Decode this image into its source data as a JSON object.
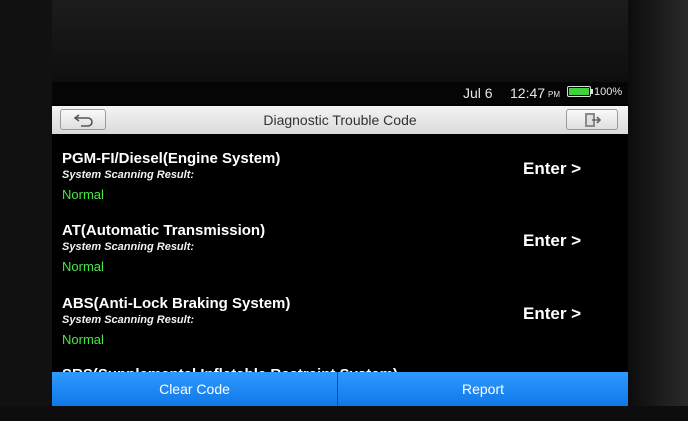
{
  "status_bar": {
    "date": "Jul 6",
    "time": "12:47",
    "ampm": "PM",
    "battery_percent": "100%",
    "battery_level": 1.0,
    "battery_color": "#3fd23a"
  },
  "header": {
    "title": "Diagnostic Trouble Code",
    "back_icon": "back-arrow-icon",
    "exit_icon": "exit-icon"
  },
  "systems": [
    {
      "name": "PGM-FI/Diesel(Engine System)",
      "result_label": "System Scanning Result:",
      "status": "Normal",
      "enter_label": "Enter >"
    },
    {
      "name": "AT(Automatic Transmission)",
      "result_label": "System Scanning Result:",
      "status": "Normal",
      "enter_label": "Enter >"
    },
    {
      "name": "ABS(Anti-Lock Braking System)",
      "result_label": "System Scanning Result:",
      "status": "Normal",
      "enter_label": "Enter >"
    },
    {
      "name": "SRS(Supplemental Inflatable Restraint System)"
    }
  ],
  "actions": {
    "clear_code": "Clear Code",
    "report": "Report"
  },
  "colors": {
    "accent": "#1a86f5",
    "status_ok": "#45e845"
  }
}
